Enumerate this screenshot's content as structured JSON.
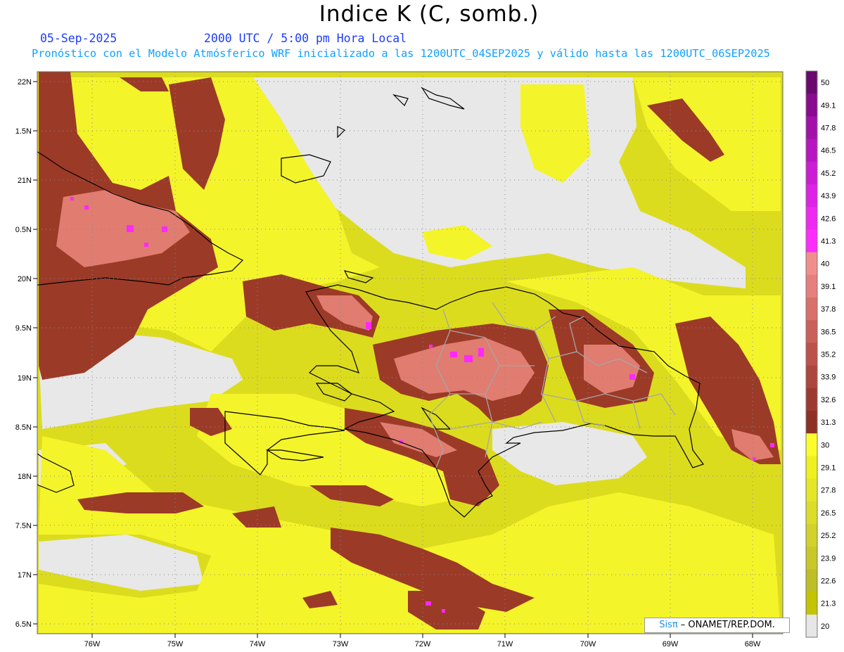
{
  "title": "Indice K (C, somb.)",
  "date": "05-Sep-2025",
  "valid_time": "2000 UTC / 5:00 pm Hora Local",
  "forecast_note": "Pronóstico con el Modelo Atmósferico WRF inicializado a las 1200UTC_04SEP2025 y válido hasta las  1200UTC_06SEP2025",
  "credit": {
    "sis": "Sisπ",
    "rest": " – ONAMET/REP.DOM."
  },
  "lat_labels": [
    "22N",
    "1.5N",
    "21N",
    "0.5N",
    "20N",
    "9.5N",
    "19N",
    "8.5N",
    "18N",
    "7.5N",
    "17N",
    "6.5N"
  ],
  "lon_labels": [
    "76W",
    "75W",
    "74W",
    "73W",
    "72W",
    "71W",
    "70W",
    "69W",
    "68W"
  ],
  "colorbar": {
    "labels": [
      "50",
      "49.1",
      "47.8",
      "46.5",
      "45.2",
      "43.9",
      "42.6",
      "41.3",
      "40",
      "39.1",
      "37.8",
      "36.5",
      "35.2",
      "33.9",
      "32.6",
      "31.3",
      "30",
      "29.1",
      "27.8",
      "26.5",
      "25.2",
      "23.9",
      "22.6",
      "21.3",
      "20"
    ],
    "colors": [
      "#6a0a6e",
      "#8a0a90",
      "#a311aa",
      "#b816c0",
      "#cc1cd4",
      "#de22e6",
      "#ef28f2",
      "#ff2cff",
      "#f08e8c",
      "#e7807c",
      "#d9706a",
      "#cb605a",
      "#bc524a",
      "#ad463c",
      "#9d3a30",
      "#8e3024",
      "#fcfc2c",
      "#f0f020",
      "#e6e628",
      "#dcdc2a",
      "#d2d22a",
      "#c8c828",
      "#bebe26",
      "#c4c400",
      "#e6e6e6"
    ]
  },
  "colors": {
    "background": "#eaeaea",
    "low_k": "#c8c800",
    "mid_k": "#f2f22a",
    "high_k": "#9c3d2a",
    "very_high_k": "#e07a70",
    "extreme_k": "#ff28ff"
  }
}
